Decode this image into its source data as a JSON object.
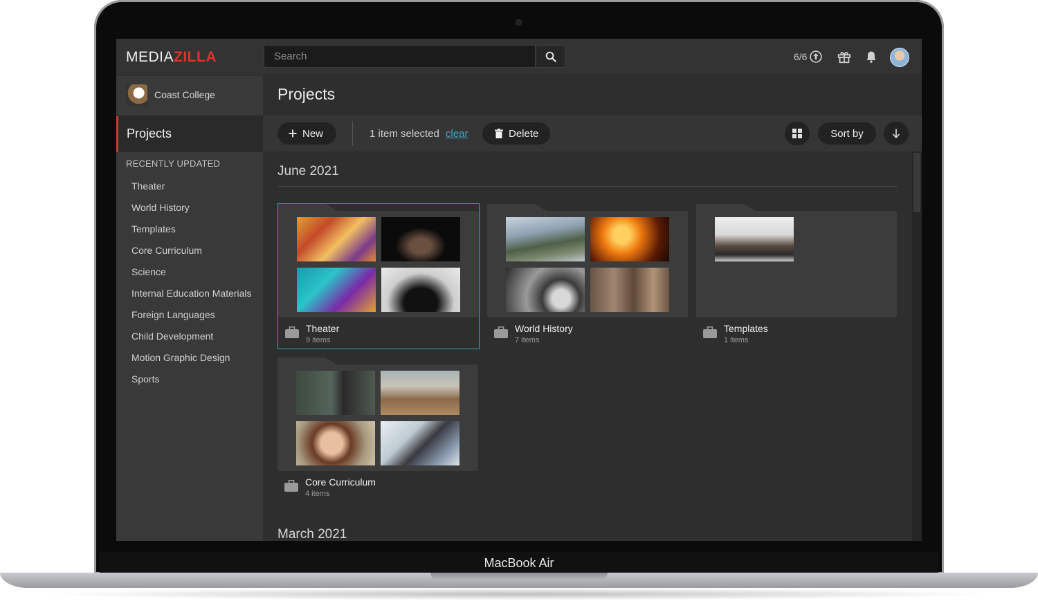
{
  "device": {
    "label": "MacBook Air"
  },
  "app": {
    "logo_light": "MEDIA",
    "logo_accent": "ZILLA"
  },
  "search": {
    "placeholder": "Search"
  },
  "header": {
    "quota": "6/6"
  },
  "org": {
    "name": "Coast College"
  },
  "nav": {
    "active": "Projects",
    "recent_heading": "RECENTLY UPDATED",
    "recent": [
      "Theater",
      "World History",
      "Templates",
      "Core Curriculum",
      "Science",
      "Internal Education Materials",
      "Foreign Languages",
      "Child Development",
      "Motion Graphic Design",
      "Sports"
    ]
  },
  "page": {
    "title": "Projects"
  },
  "toolbar": {
    "new_label": "New",
    "selection_text": "1 item selected",
    "clear_label": "clear",
    "delete_label": "Delete",
    "sort_label": "Sort by"
  },
  "sections": [
    {
      "title": "June 2021",
      "projects": [
        {
          "name": "Theater",
          "count": "9 items",
          "selected": true
        },
        {
          "name": "World History",
          "count": "7 items",
          "selected": false
        },
        {
          "name": "Templates",
          "count": "1 items",
          "selected": false
        },
        {
          "name": "Core Curriculum",
          "count": "4 items",
          "selected": false
        }
      ]
    },
    {
      "title": "March 2021"
    }
  ],
  "colors": {
    "accent": "#e0322c",
    "link": "#3fa6c8",
    "selection": "#2ea8b8"
  }
}
